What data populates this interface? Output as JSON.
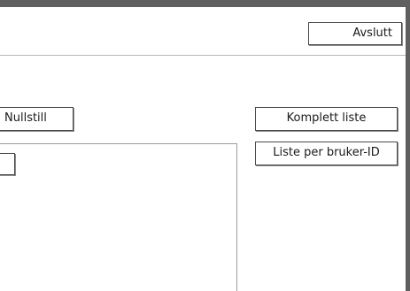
{
  "header": {
    "exit_label": "Avslutt"
  },
  "toolbar": {
    "reset_label": "Nullstill",
    "full_list_label": "Komplett liste",
    "per_user_label": "Liste per bruker-ID"
  },
  "list": {
    "rows": [
      {
        "label": ""
      }
    ]
  }
}
